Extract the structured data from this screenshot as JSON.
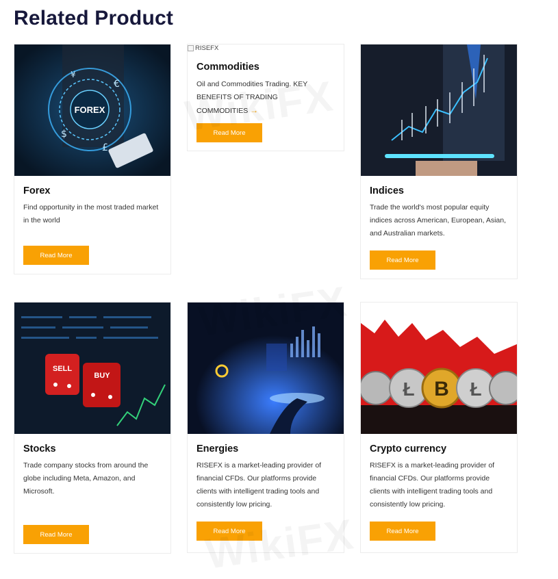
{
  "heading": "Related Product",
  "watermark": "WikiFX",
  "accent_color": "#f9a104",
  "cards": [
    {
      "title": "Forex",
      "desc": "Find opportunity in the most traded market in the world",
      "button": "Read More",
      "image_label": "FOREX"
    },
    {
      "title": "Commodities",
      "desc": "Oil and Commodities Trading. KEY BENEFITS OF TRADING COMMODITIES",
      "button": "Read More",
      "image_alt": "RISEFX",
      "arrow": "→"
    },
    {
      "title": "Indices",
      "desc": "Trade the world's most popular equity indices across American, European, Asian, and Australian markets.",
      "button": "Read More"
    },
    {
      "title": "Stocks",
      "desc": "Trade company stocks from around the globe including Meta, Amazon, and Microsoft.",
      "button": "Read More",
      "image_label_1": "SELL",
      "image_label_2": "BUY"
    },
    {
      "title": "Energies",
      "desc": "RISEFX is a market-leading provider of financial CFDs. Our platforms provide clients with intelligent trading tools and consistently low pricing.",
      "button": "Read More"
    },
    {
      "title": "Crypto currency",
      "desc": "RISEFX is a market-leading provider of financial CFDs. Our platforms provide clients with intelligent trading tools and consistently low pricing.",
      "button": "Read More"
    }
  ]
}
